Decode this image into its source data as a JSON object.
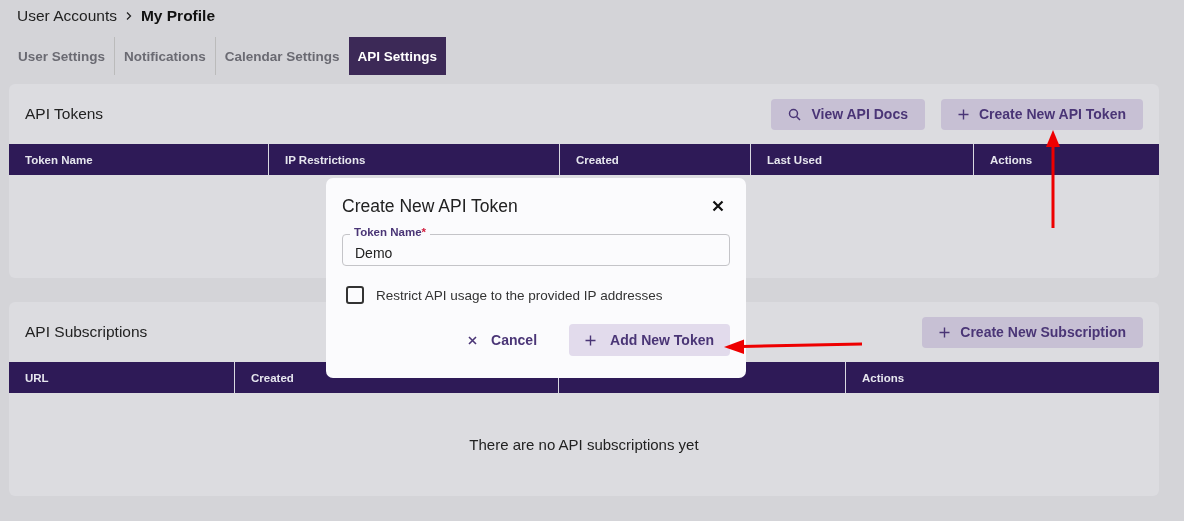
{
  "breadcrumb": [
    {
      "label": "User Accounts",
      "current": false
    },
    {
      "label": "My Profile",
      "current": true
    }
  ],
  "tabs": [
    {
      "label": "User Settings",
      "selected": false
    },
    {
      "label": "Notifications",
      "selected": false
    },
    {
      "label": "Calendar Settings",
      "selected": false
    },
    {
      "label": "API Settings",
      "selected": true
    }
  ],
  "panels": [
    {
      "title": "API Tokens",
      "buttons": [
        "View API Docs",
        "Create New API Token"
      ],
      "columns": [
        "Token Name",
        "IP Restrictions",
        "Created",
        "Last Used",
        "Actions"
      ]
    },
    {
      "title": "API Subscriptions",
      "buttons": [
        "Create New Subscription"
      ],
      "columns": [
        "URL",
        "Created",
        "Actions"
      ],
      "empty_text": "There are no API subscriptions yet"
    }
  ],
  "dialog": {
    "title": "Create New API Token",
    "field": {
      "label": "Token Name",
      "required_mark": "*",
      "value": "Demo"
    },
    "checkbox": {
      "label": "Restrict API usage to the provided IP addresses",
      "checked": false
    },
    "buttons": [
      {
        "label": "Cancel",
        "kind": "text"
      },
      {
        "label": "Add New Token",
        "kind": "filled"
      }
    ]
  }
}
